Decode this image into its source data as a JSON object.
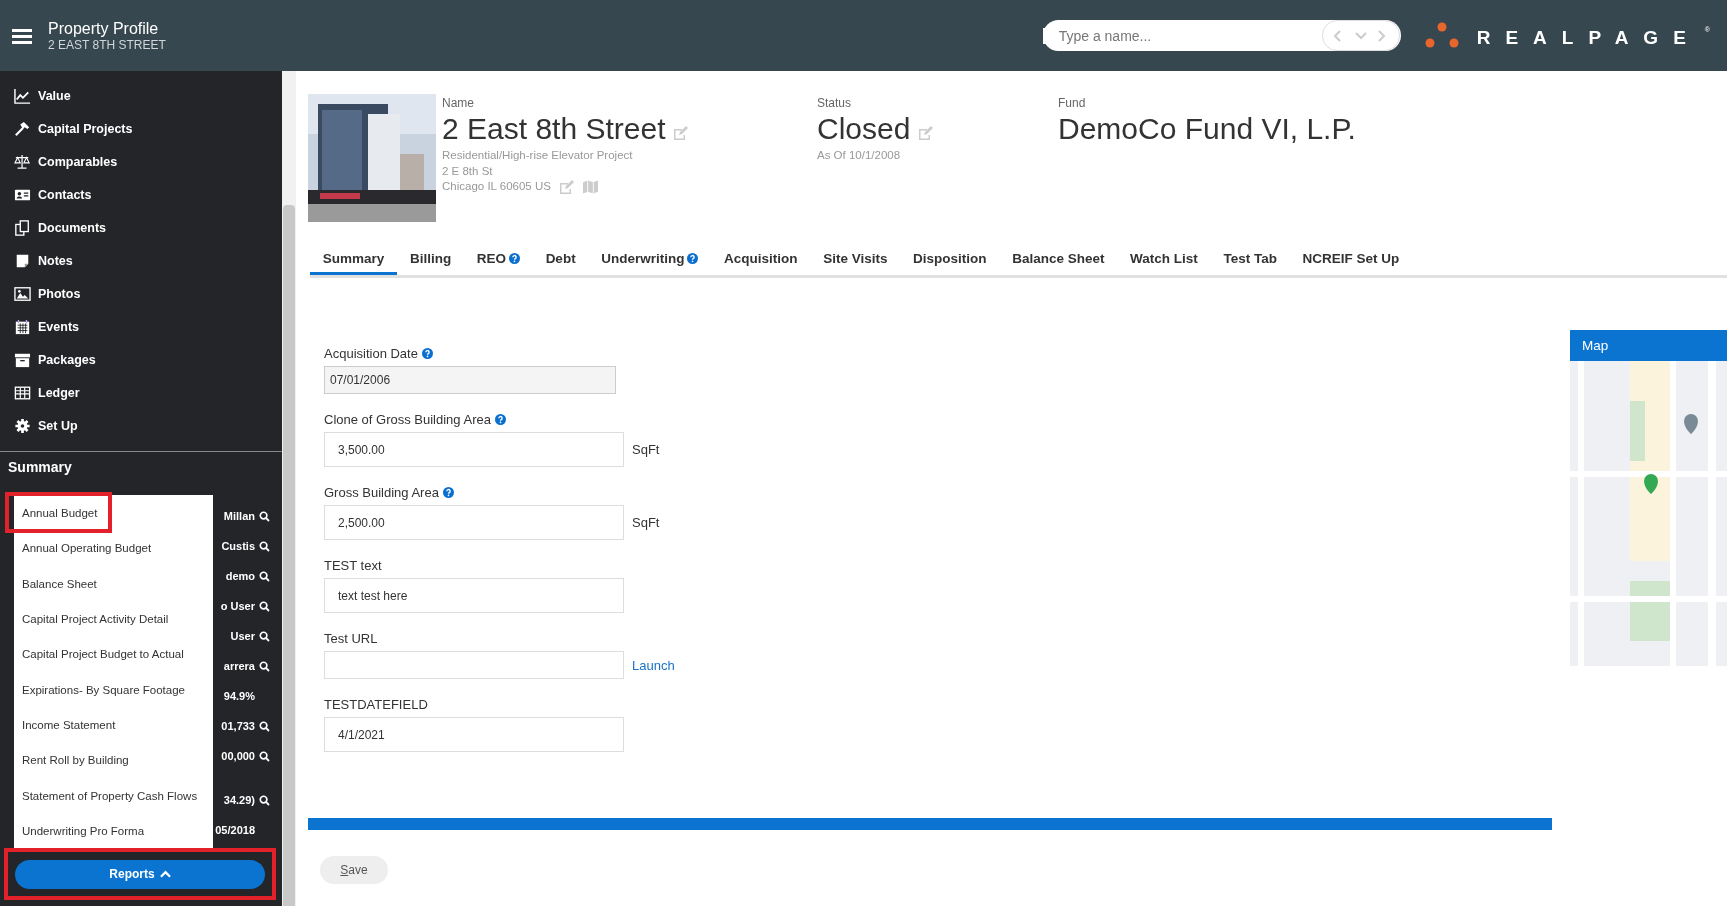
{
  "header": {
    "title": "Property Profile",
    "subtitle": "2 EAST 8TH STREET",
    "search": {
      "placeholder": "Type a name..."
    },
    "logo": {
      "text": "REALPAGE",
      "mark": "®"
    }
  },
  "sidebar": {
    "items": [
      {
        "label": "Value"
      },
      {
        "label": "Capital Projects"
      },
      {
        "label": "Comparables"
      },
      {
        "label": "Contacts"
      },
      {
        "label": "Documents"
      },
      {
        "label": "Notes"
      },
      {
        "label": "Photos"
      },
      {
        "label": "Events"
      },
      {
        "label": "Packages"
      },
      {
        "label": "Ledger"
      },
      {
        "label": "Set Up"
      }
    ],
    "section_title": "Summary",
    "summary_rows": [
      {
        "text": "Millan",
        "search": true
      },
      {
        "text": "Custis",
        "search": true
      },
      {
        "text": "demo",
        "search": true
      },
      {
        "text": "o User",
        "search": true
      },
      {
        "text": "User",
        "search": true
      },
      {
        "text": "arrera",
        "search": true
      },
      {
        "text": "94.9%",
        "search": false
      },
      {
        "text": "01,733",
        "search": true
      },
      {
        "text": "00,000",
        "search": true
      },
      {
        "text": "34.29)",
        "search": true
      },
      {
        "text": "05/2018",
        "search": false
      }
    ]
  },
  "reports_menu": {
    "items": [
      {
        "label": "Annual Budget",
        "highlighted": true
      },
      {
        "label": "Annual Operating Budget",
        "highlighted": false
      },
      {
        "label": "Balance Sheet",
        "highlighted": false
      },
      {
        "label": "Capital Project Activity Detail",
        "highlighted": false
      },
      {
        "label": "Capital Project Budget to Actual",
        "highlighted": false
      },
      {
        "label": "Expirations- By Square Footage",
        "highlighted": false
      },
      {
        "label": "Income Statement",
        "highlighted": false
      },
      {
        "label": "Rent Roll by Building",
        "highlighted": false
      },
      {
        "label": "Statement of Property Cash Flows",
        "highlighted": false
      },
      {
        "label": "Underwriting Pro Forma",
        "highlighted": false
      }
    ],
    "button": {
      "label": "Reports",
      "expanded": true,
      "highlighted": true
    }
  },
  "property": {
    "name_label": "Name",
    "name": "2 East 8th Street",
    "type": "Residential/High-rise Elevator Project",
    "address_line": "2 E 8th St",
    "city_line": "Chicago IL 60605 US",
    "status_label": "Status",
    "status": "Closed",
    "status_date": "As Of 10/1/2008",
    "fund_label": "Fund",
    "fund": "DemoCo Fund VI, L.P."
  },
  "tabs": [
    {
      "label": "Summary",
      "selected": true,
      "help": false
    },
    {
      "label": "Billing",
      "selected": false,
      "help": false
    },
    {
      "label": "REO",
      "selected": false,
      "help": true
    },
    {
      "label": "Debt",
      "selected": false,
      "help": false
    },
    {
      "label": "Underwriting",
      "selected": false,
      "help": true
    },
    {
      "label": "Acquisition",
      "selected": false,
      "help": false
    },
    {
      "label": "Site Visits",
      "selected": false,
      "help": false
    },
    {
      "label": "Disposition",
      "selected": false,
      "help": false
    },
    {
      "label": "Balance Sheet",
      "selected": false,
      "help": false
    },
    {
      "label": "Watch List",
      "selected": false,
      "help": false
    },
    {
      "label": "Test Tab",
      "selected": false,
      "help": false
    },
    {
      "label": "NCREIF Set Up",
      "selected": false,
      "help": false
    }
  ],
  "fields": [
    {
      "label": "Acquisition Date",
      "help": true,
      "value": "07/01/2006",
      "disabled": true
    },
    {
      "label": "Clone of Gross Building Area",
      "help": true,
      "value": "3,500.00",
      "disabled": false,
      "unit": "SqFt"
    },
    {
      "label": "Gross Building Area",
      "help": true,
      "value": "2,500.00",
      "disabled": false,
      "unit": "SqFt"
    },
    {
      "label": "TEST text",
      "help": false,
      "value": "text test here",
      "disabled": false
    },
    {
      "label": "Test URL",
      "help": false,
      "disabled": false,
      "link": "Launch"
    },
    {
      "label": "TESTDATEFIELD",
      "help": false,
      "value": "4/1/2021",
      "disabled": false
    }
  ],
  "map": {
    "title": "Map"
  },
  "save_button": {
    "label": "Save"
  }
}
